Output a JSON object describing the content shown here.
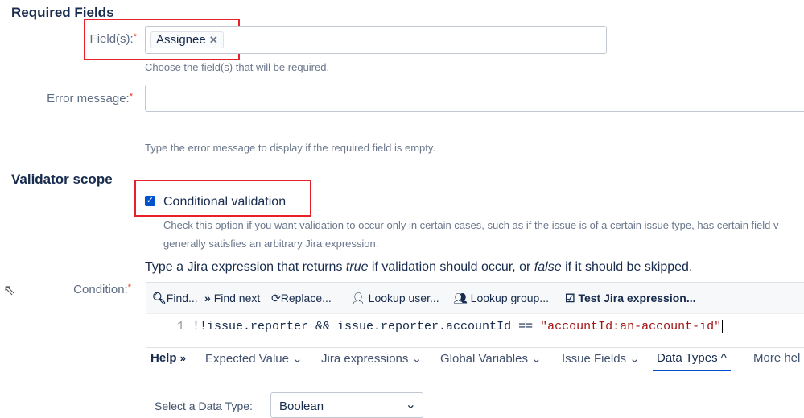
{
  "required_fields": {
    "heading": "Required Fields",
    "fields_label": "Field(s):",
    "fields_tag": "Assignee",
    "fields_help": "Choose the field(s) that will be required.",
    "error_label": "Error message:",
    "error_value": "",
    "error_help": "Type the error message to display if the required field is empty."
  },
  "scope": {
    "heading": "Validator scope",
    "checkbox_label": "Conditional validation",
    "checked": true,
    "help_line1": "Check this option if you want validation to occur only in certain cases, such as if the issue is of a certain issue type, has certain field v",
    "help_line2": "generally satisfies an arbitrary Jira expression.",
    "expr_pre": "Type a Jira expression that returns ",
    "expr_true": "true",
    "expr_mid": " if validation should occur, or ",
    "expr_false": "false",
    "expr_post": " if it should be skipped."
  },
  "condition": {
    "label": "Condition:",
    "toolbar": [
      "Find...",
      "Find next",
      "Replace...",
      "Lookup user...",
      "Lookup group...",
      "Test Jira expression..."
    ],
    "line_number": "1",
    "code": "!!issue.reporter && issue.reporter.accountId == ",
    "code_string": "\"accountId:an-account-id\""
  },
  "help_tabs": {
    "help": "Help",
    "tabs": [
      "Expected Value",
      "Jira expressions",
      "Global Variables",
      "Issue Fields",
      "Data Types",
      "More hel"
    ],
    "active": "Data Types"
  },
  "data_type": {
    "label": "Select a Data Type:",
    "value": "Boolean"
  }
}
